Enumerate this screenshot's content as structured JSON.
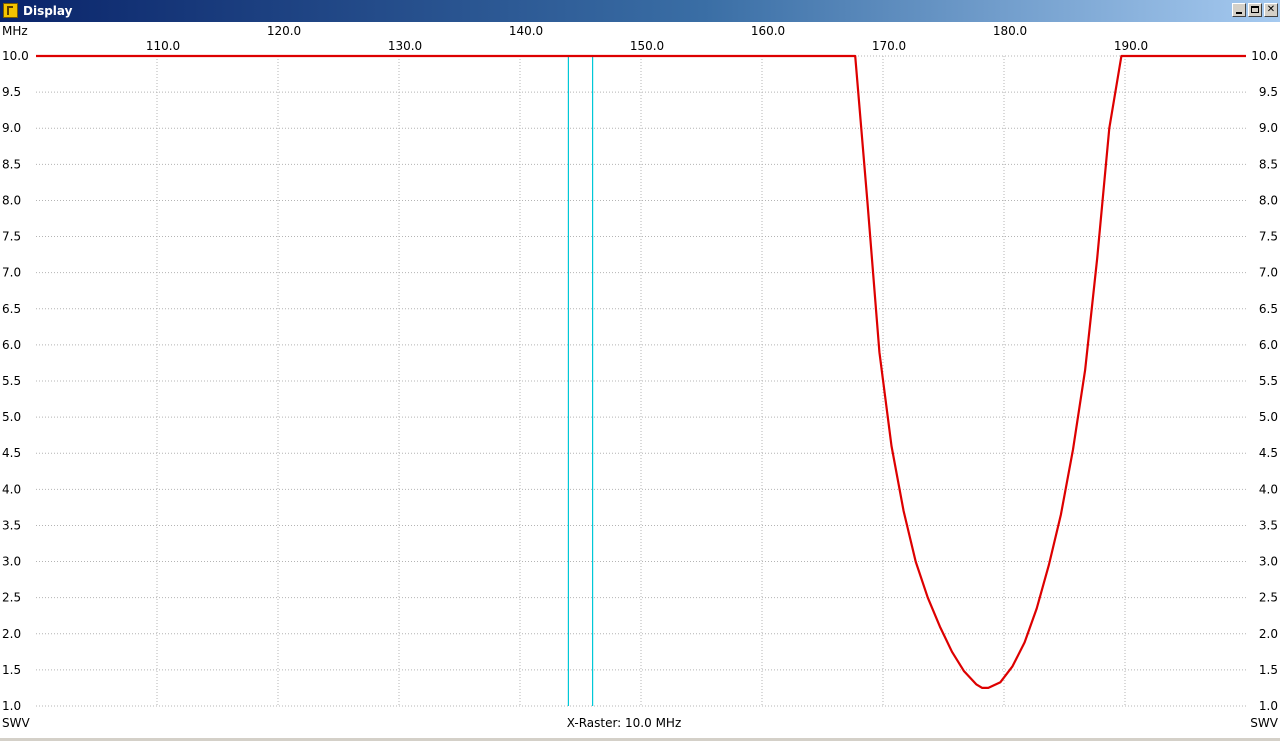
{
  "window": {
    "title": "Display",
    "controls": [
      "minimize",
      "maximize",
      "close"
    ]
  },
  "colors": {
    "trace": "#dd0000",
    "marker": "#00c8d8",
    "grid": "#b4b4b4",
    "text": "#000000"
  },
  "chart_data": {
    "type": "line",
    "x_unit_label": "MHz",
    "y_label": "SWV",
    "footer": "X-Raster: 10.0 MHz",
    "xlim": [
      100.0,
      200.0
    ],
    "ylim": [
      1.0,
      10.0
    ],
    "x_ticks": [
      110.0,
      120.0,
      130.0,
      140.0,
      150.0,
      160.0,
      170.0,
      180.0,
      190.0
    ],
    "x_tick_labels": [
      "110.0",
      "120.0",
      "130.0",
      "140.0",
      "150.0",
      "160.0",
      "170.0",
      "180.0",
      "190.0"
    ],
    "y_ticks": [
      1.0,
      1.5,
      2.0,
      2.5,
      3.0,
      3.5,
      4.0,
      4.5,
      5.0,
      5.5,
      6.0,
      6.5,
      7.0,
      7.5,
      8.0,
      8.5,
      9.0,
      9.5,
      10.0
    ],
    "y_tick_labels": [
      "1.0",
      "1.5",
      "2.0",
      "2.5",
      "3.0",
      "3.5",
      "4.0",
      "4.5",
      "5.0",
      "5.5",
      "6.0",
      "6.5",
      "7.0",
      "7.5",
      "8.0",
      "8.5",
      "9.0",
      "9.5",
      "10.0"
    ],
    "markers_x": [
      144.0,
      146.0
    ],
    "series": [
      {
        "x": [
          100.0,
          167.7,
          168.7,
          169.7,
          170.7,
          171.7,
          172.7,
          173.7,
          174.7,
          175.7,
          176.7,
          177.7,
          178.2,
          178.7,
          179.7,
          180.7,
          181.7,
          182.7,
          183.7,
          184.7,
          185.7,
          186.7,
          187.7,
          188.7,
          189.7,
          190.6,
          200.0
        ],
        "y": [
          10.0,
          10.0,
          8.0,
          5.9,
          4.6,
          3.7,
          3.0,
          2.5,
          2.1,
          1.75,
          1.48,
          1.3,
          1.25,
          1.25,
          1.33,
          1.55,
          1.88,
          2.35,
          2.95,
          3.65,
          4.55,
          5.65,
          7.2,
          9.0,
          10.0,
          10.0,
          10.0
        ]
      }
    ]
  }
}
